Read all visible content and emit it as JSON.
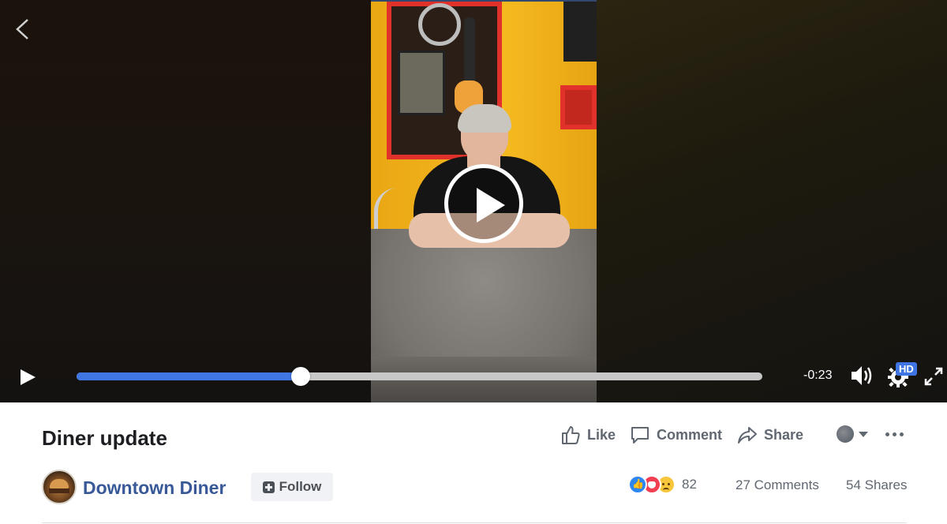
{
  "video": {
    "time_remaining": "-0:23",
    "progress_fraction": 0.327,
    "hd_label": "HD"
  },
  "post": {
    "title": "Diner update",
    "actions": {
      "like_label": "Like",
      "comment_label": "Comment",
      "share_label": "Share"
    },
    "page_name": "Downtown Diner",
    "follow_label": "Follow",
    "reaction_count": "82",
    "comments_text": "27 Comments",
    "shares_text": "54 Shares"
  },
  "colors": {
    "accent_blue": "#3f76e4",
    "link_blue": "#385898",
    "text_gray": "#606770"
  },
  "icons": {
    "back": "chevron-left-icon",
    "play": "play-icon",
    "volume": "volume-icon",
    "settings": "gear-icon",
    "fullscreen": "fullscreen-icon",
    "like": "thumbs-up-icon",
    "comment": "speech-bubble-icon",
    "share": "share-arrow-icon",
    "audience": "globe-icon",
    "more": "more-dots-icon"
  }
}
